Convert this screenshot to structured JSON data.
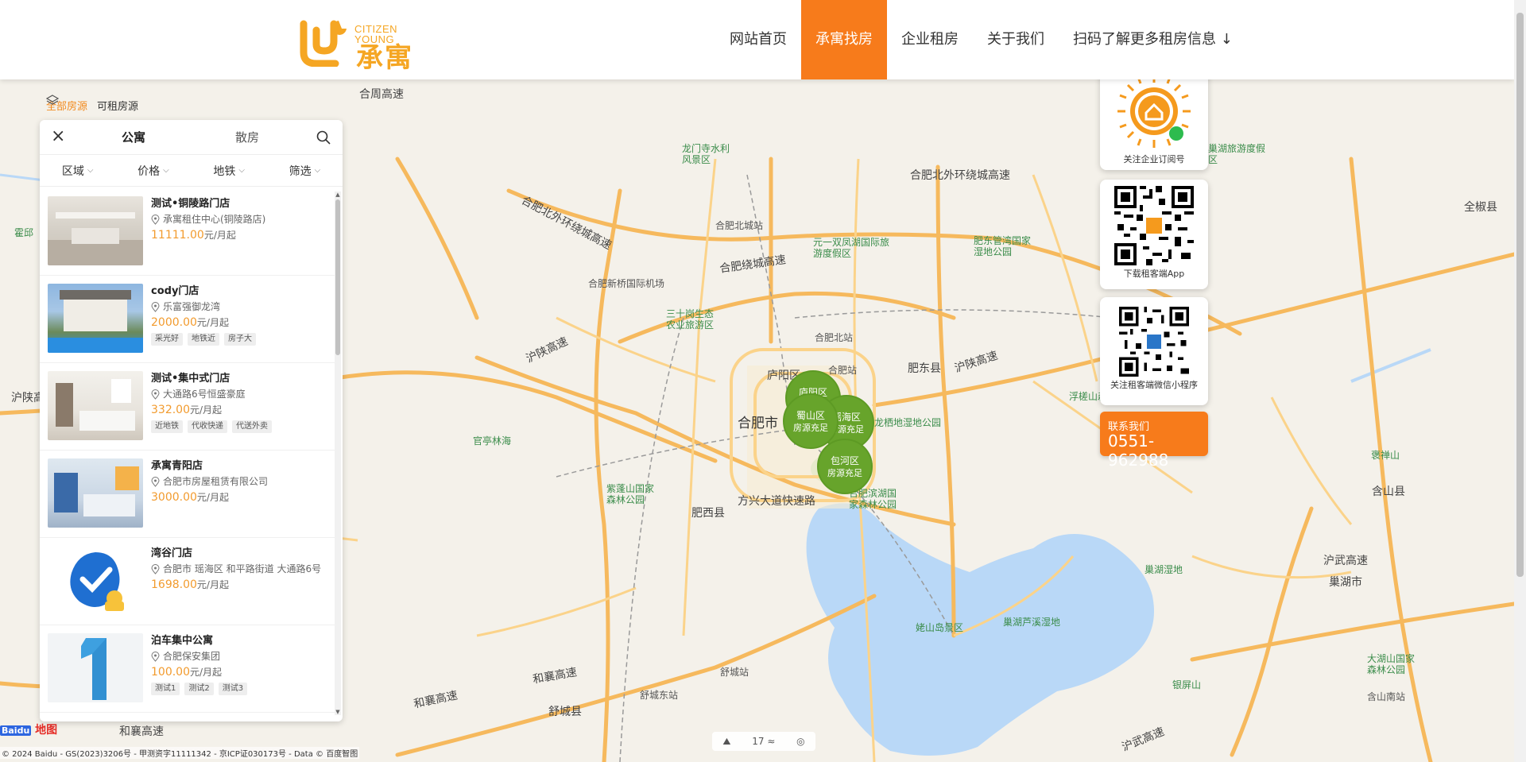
{
  "brand": {
    "en": "CITIZEN\nYOUNG",
    "en1": "CITIZEN",
    "en2": "YOUNG",
    "cn": "承寓"
  },
  "nav": [
    {
      "label": "网站首页",
      "active": false
    },
    {
      "label": "承寓找房",
      "active": true
    },
    {
      "label": "企业租房",
      "active": false
    },
    {
      "label": "关于我们",
      "active": false
    },
    {
      "label": "扫码了解更多租房信息 ↓",
      "active": false
    }
  ],
  "layers": {
    "all": "全部房源",
    "available": "可租房源"
  },
  "panel": {
    "tabs": [
      "公寓",
      "散房"
    ],
    "filters": [
      "区域",
      "价格",
      "地铁",
      "筛选"
    ],
    "items": [
      {
        "name": "测试•铜陵路门店",
        "addr": "承寓租住中心(铜陵路店)",
        "price": "11111.00",
        "unit": "元/月起",
        "tags": []
      },
      {
        "name": "cody门店",
        "addr": "乐富强御龙湾",
        "price": "2000.00",
        "unit": "元/月起",
        "tags": [
          "采光好",
          "地铁近",
          "房子大"
        ]
      },
      {
        "name": "测试•集中式门店",
        "addr": "大通路6号恒盛豪庭",
        "price": "332.00",
        "unit": "元/月起",
        "tags": [
          "近地铁",
          "代收快递",
          "代送外卖"
        ]
      },
      {
        "name": "承寓青阳店",
        "addr": "合肥市房屋租赁有限公司",
        "price": "3000.00",
        "unit": "元/月起",
        "tags": []
      },
      {
        "name": "湾谷门店",
        "addr": "合肥市 瑶海区 和平路街道 大通路6号",
        "price": "1698.00",
        "unit": "元/月起",
        "tags": []
      },
      {
        "name": "泊车集中公寓",
        "addr": "合肥保安集团",
        "price": "100.00",
        "unit": "元/月起",
        "tags": [
          "测试1",
          "测试2",
          "测试3"
        ]
      }
    ]
  },
  "qr": [
    {
      "caption": "关注企业订阅号",
      "icon": "mini-program-qr-icon"
    },
    {
      "caption": "下载租客端App",
      "icon": "app-qr-icon"
    },
    {
      "caption": "关注租客端微信小程序",
      "icon": "wechat-qr-icon"
    }
  ],
  "contact": {
    "label": "联系我们",
    "phone": "0551-962988"
  },
  "map": {
    "clusters": [
      {
        "district": "庐阳区",
        "sub": ""
      },
      {
        "district": "蜀山区",
        "sub": "房源充足"
      },
      {
        "district": "瑶海区",
        "sub": "房源充足"
      },
      {
        "district": "包河区",
        "sub": "房源充足"
      }
    ],
    "city": "合肥市",
    "labels": {
      "l1": "合肥北外环绕城高速",
      "l2": "合肥北外环绕城高速",
      "l3": "合肥绕城高速",
      "l4": "沪陕高速",
      "l5": "沪陕高速",
      "l6": "方兴大道快速路",
      "l7": "和襄高速",
      "l8": "和襄高速",
      "l9": "和襄高速",
      "l10": "沪武高速",
      "l11": "沪武高速",
      "l12": "合周高速",
      "l13": "肥东县",
      "l14": "肥西县",
      "l15": "舒城县",
      "l16": "含山县",
      "l17": "巢湖市",
      "l18": "全椒县",
      "l19": "庐阳区",
      "l20": "合肥新桥国际机场",
      "l21": "合肥北城站",
      "l22": "合肥北站",
      "l23": "合肥站",
      "l24": "舒城站",
      "l25": "舒城东站",
      "l26": "含山南站",
      "s1": "龙门寺水利风景区",
      "s2": "元一双凤湖国际旅游度假区",
      "s3": "肥东管湾国家湿地公园",
      "s4": "三十岗生态农业旅游区",
      "s5": "官亭林海",
      "s6": "紫蓬山国家森林公园",
      "s7": "合肥滨湖国家森林公园",
      "s8": "巢湖芦溪湿地",
      "s9": "姥山岛景区",
      "s10": "浮槎山森林",
      "s11": "褒禅山",
      "s12": "大湖山国家森林公园",
      "s13": "银屏山",
      "s14": "巢湖湿地",
      "s15": "龙栖地湿地公园",
      "s16": "沪陕高",
      "s17": "巢湖旅游度假区",
      "s18": "霍邱"
    },
    "zoom": "17",
    "zoom_unit": "≈",
    "baidu": "Baidu",
    "baidu_map": "地图",
    "copyright": "© 2024 Baidu - GS(2023)3206号 - 甲测资字11111342 - 京ICP证030173号 - Data © 百度智图"
  }
}
